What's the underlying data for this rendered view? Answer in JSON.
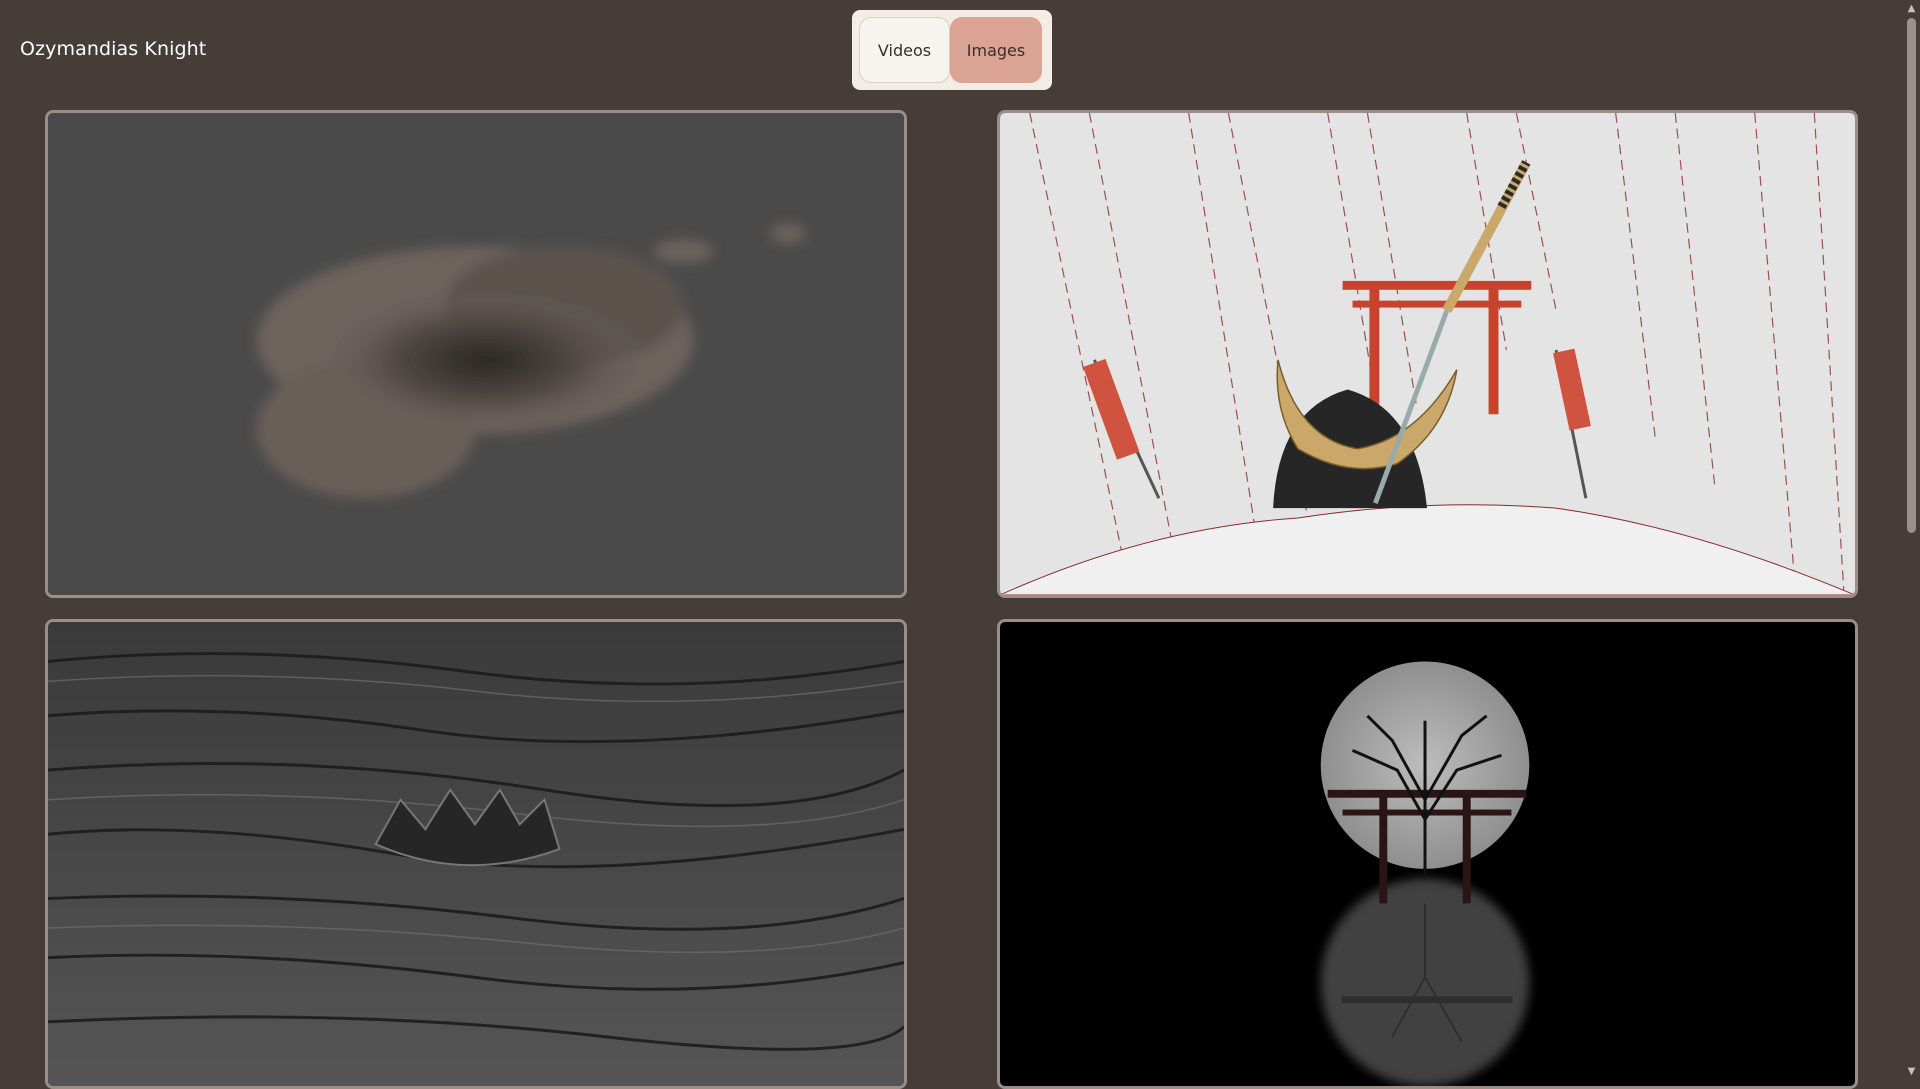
{
  "header": {
    "site_title": "Ozymandias Knight"
  },
  "tabs": [
    {
      "label": "Videos",
      "active": false
    },
    {
      "label": "Images",
      "active": true
    }
  ],
  "gallery": {
    "items": [
      {
        "subject": "cloud-render"
      },
      {
        "subject": "samurai-helmet-katana-torii-render"
      },
      {
        "subject": "rock-terrain-crown-render"
      },
      {
        "subject": "moon-torii-tree-reflection-render"
      }
    ]
  },
  "colors": {
    "background": "#473d38",
    "tab_active": "#dba394",
    "tab_group_bg": "#f3ede6",
    "card_border": "#9b8e87"
  }
}
